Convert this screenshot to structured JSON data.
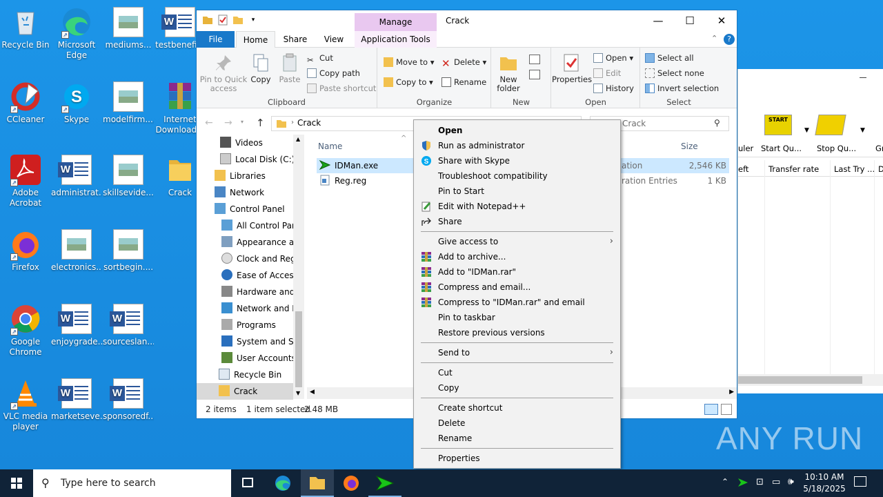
{
  "desktop": {
    "icons": [
      {
        "label": "Recycle Bin",
        "icon": "recycle-bin-icon"
      },
      {
        "label": "Microsoft Edge",
        "icon": "edge-icon"
      },
      {
        "label": "mediums...",
        "icon": "image-file-icon"
      },
      {
        "label": "testbenefi...",
        "icon": "word-doc-icon"
      },
      {
        "label": "CCleaner",
        "icon": "ccleaner-icon"
      },
      {
        "label": "Skype",
        "icon": "skype-icon"
      },
      {
        "label": "modelfirm....",
        "icon": "image-file-icon"
      },
      {
        "label": "Internet Download...",
        "icon": "winrar-icon"
      },
      {
        "label": "Adobe Acrobat",
        "icon": "acrobat-icon"
      },
      {
        "label": "administrat...",
        "icon": "word-doc-icon"
      },
      {
        "label": "skillsevide...",
        "icon": "image-file-icon"
      },
      {
        "label": "Crack",
        "icon": "folder-icon"
      },
      {
        "label": "Firefox",
        "icon": "firefox-icon"
      },
      {
        "label": "electronics....",
        "icon": "image-file-icon"
      },
      {
        "label": "sortbegin....",
        "icon": "image-file-icon"
      },
      {
        "label": "Google Chrome",
        "icon": "chrome-icon"
      },
      {
        "label": "enjoygrade....",
        "icon": "word-doc-icon"
      },
      {
        "label": "sourceslan....",
        "icon": "word-doc-icon"
      },
      {
        "label": "VLC media player",
        "icon": "vlc-icon"
      },
      {
        "label": "marketseve....",
        "icon": "word-doc-icon"
      },
      {
        "label": "sponsoredf...",
        "icon": "word-doc-icon"
      }
    ]
  },
  "explorer": {
    "title": "Crack",
    "manage_label": "Manage",
    "tabs": {
      "file": "File",
      "home": "Home",
      "share": "Share",
      "view": "View",
      "app_tools": "Application Tools"
    },
    "clipboard": {
      "pin": "Pin to Quick access",
      "copy": "Copy",
      "paste": "Paste",
      "cut": "Cut",
      "copy_path": "Copy path",
      "paste_shortcut": "Paste shortcut",
      "label": "Clipboard"
    },
    "organize": {
      "move_to": "Move to",
      "copy_to": "Copy to",
      "delete": "Delete",
      "rename": "Rename",
      "label": "Organize"
    },
    "new": {
      "new_folder": "New folder",
      "label": "New"
    },
    "open": {
      "properties": "Properties",
      "open": "Open",
      "edit": "Edit",
      "history": "History",
      "label": "Open"
    },
    "select": {
      "select_all": "Select all",
      "select_none": "Select none",
      "invert": "Invert selection",
      "label": "Select"
    },
    "address": {
      "path": "Crack",
      "search_placeholder": "Crack"
    },
    "nav": [
      {
        "label": "Videos"
      },
      {
        "label": "Local Disk (C:)"
      },
      {
        "label": "Libraries"
      },
      {
        "label": "Network"
      },
      {
        "label": "Control Panel"
      },
      {
        "label": "All Control Par"
      },
      {
        "label": "Appearance an"
      },
      {
        "label": "Clock and Regi"
      },
      {
        "label": "Ease of Access"
      },
      {
        "label": "Hardware and"
      },
      {
        "label": "Network and Ir"
      },
      {
        "label": "Programs"
      },
      {
        "label": "System and Se"
      },
      {
        "label": "User Accounts"
      },
      {
        "label": "Recycle Bin"
      },
      {
        "label": "Crack"
      }
    ],
    "columns": {
      "name": "Name",
      "size": "Size"
    },
    "files": [
      {
        "name": "IDMan.exe",
        "type": "ation",
        "size": "2,546 KB"
      },
      {
        "name": "Reg.reg",
        "type": "ration Entries",
        "size": "1 KB"
      }
    ],
    "status": {
      "items": "2 items",
      "selected": "1 item selected",
      "size": "2.48 MB"
    }
  },
  "bgapp": {
    "toolbar": [
      "uler",
      "Start Qu...",
      "Stop Qu...",
      "Gr"
    ],
    "columns": [
      "eft",
      "Transfer rate",
      "Last Try ...",
      "D"
    ],
    "start_badge": "START"
  },
  "context_menu": {
    "items": [
      {
        "label": "Open",
        "icon": ""
      },
      {
        "label": "Run as administrator",
        "icon": "uac-shield-icon"
      },
      {
        "label": "Share with Skype",
        "icon": "skype-icon"
      },
      {
        "label": "Troubleshoot compatibility",
        "icon": ""
      },
      {
        "label": "Pin to Start",
        "icon": ""
      },
      {
        "label": "Edit with Notepad++",
        "icon": "notepad-plus-icon"
      },
      {
        "label": "Share",
        "icon": "share-icon"
      },
      {
        "label": "Give access to",
        "icon": ""
      },
      {
        "label": "Add to archive...",
        "icon": "winrar-icon"
      },
      {
        "label": "Add to \"IDMan.rar\"",
        "icon": "winrar-icon"
      },
      {
        "label": "Compress and email...",
        "icon": "winrar-icon"
      },
      {
        "label": "Compress to \"IDMan.rar\" and email",
        "icon": "winrar-icon"
      },
      {
        "label": "Pin to taskbar",
        "icon": ""
      },
      {
        "label": "Restore previous versions",
        "icon": ""
      },
      {
        "label": "Send to",
        "icon": ""
      },
      {
        "label": "Cut",
        "icon": ""
      },
      {
        "label": "Copy",
        "icon": ""
      },
      {
        "label": "Create shortcut",
        "icon": ""
      },
      {
        "label": "Delete",
        "icon": ""
      },
      {
        "label": "Rename",
        "icon": ""
      },
      {
        "label": "Properties",
        "icon": ""
      }
    ],
    "submenu_arrow": "›"
  },
  "taskbar": {
    "search_placeholder": "Type here to search",
    "time": "10:10 AM",
    "date": "5/18/2025"
  },
  "watermark": "ANY RUN",
  "colors": {
    "accent": "#1979ca",
    "desktop": "#1787db",
    "taskbar": "#102338",
    "selection": "#cce8ff"
  }
}
